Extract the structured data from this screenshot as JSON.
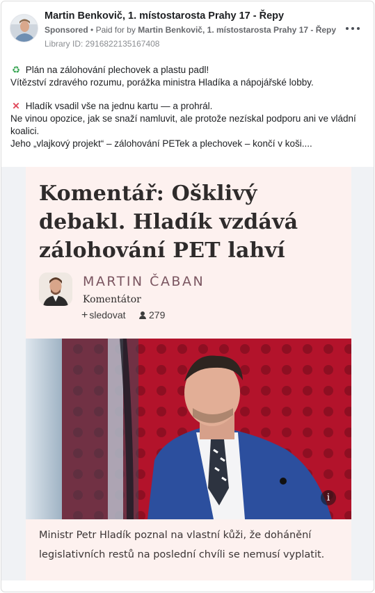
{
  "post": {
    "page_name": "Martin Benkovič, 1. místostarosta Prahy 17 - Řepy",
    "sponsored_label": "Sponsored",
    "paid_for_label": "Paid for by",
    "payer": "Martin Benkovič, 1. místostarosta Prahy 17 - Řepy",
    "library_id": "Library ID: 2916822135167408",
    "more_icon": "more-horizontal-icon",
    "text": {
      "line1": "Plán na zálohování plechovek a plastu padl!",
      "line2": "Vítězství zdravého rozumu, porážka ministra Hladíka a nápojářské lobby.",
      "line3": "Hladík vsadil vše na jednu kartu — a prohrál.",
      "line4": "Ne vinou opozice, jak se snaží namluvit, ale protože nezískal podporu ani ve vládní koalici.",
      "line5": "Jeho „vlajkový projekt“ – zálohování PETek a plechovek – končí v koši...."
    },
    "emoji1": "recycle-icon",
    "emoji2": "cross-mark-icon"
  },
  "article": {
    "headline": "Komentář: Ošklivý debakl. Hladík vzdává zálohování PET lahví",
    "author_name": "MARTIN ČABAN",
    "author_role": "Komentátor",
    "follow_label": "sledovat",
    "followers_count": "279",
    "photo_info": "i",
    "caption": "Ministr Petr Hladík poznal na vlastní kůži, že dohánění legislativních restů na poslední chvíli se nemusí vyplatit."
  },
  "colors": {
    "article_bg": "#fdf1ef",
    "author_name": "#7a5560",
    "photo_bg": "#b3132b",
    "jacket": "#2c4f9e"
  }
}
